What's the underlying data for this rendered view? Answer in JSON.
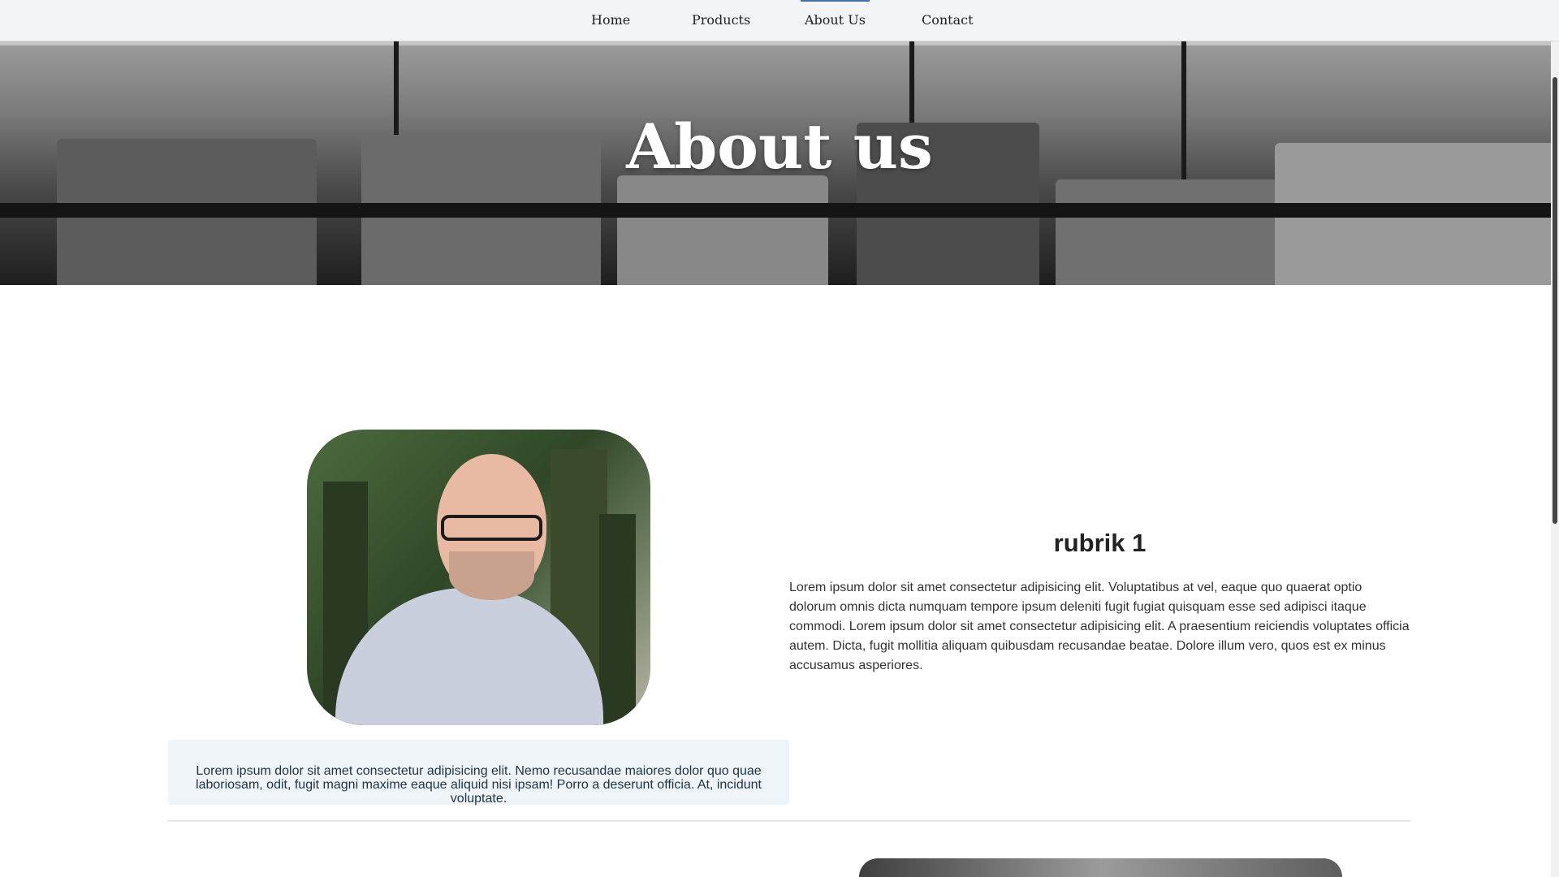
{
  "nav": {
    "items": [
      "Home",
      "Products",
      "About Us",
      "Contact"
    ],
    "active_item": "About Us",
    "active_color": "#3f6fa8"
  },
  "hero": {
    "title": "About us"
  },
  "profile": {
    "caption": "Lorem ipsum dolor sit amet consectetur adipisicing elit. Nemo recusandae maiores dolor quo quae laboriosam, odit, fugit magni maxime eaque aliquid nisi ipsam! Porro a deserunt officia. At, incidunt voluptate.",
    "title": "rubrik 1",
    "body": "Lorem ipsum dolor sit amet consectetur adipisicing elit. Voluptatibus at vel, eaque quo quaerat optio dolorum omnis dicta numquam tempore ipsum deleniti fugit fugiat quisquam esse sed adipisci itaque commodi. Lorem ipsum dolor sit amet consectetur adipisicing elit. A praesentium reiciendis voluptates officia autem. Dicta, fugit mollitia aliquam quibusdam recusandae beatae. Dolore illum vero, quos est ex minus accusamus asperiores."
  },
  "colors": {
    "caption_background": "#eef4f7",
    "nav_background": "#f3f4f5"
  }
}
